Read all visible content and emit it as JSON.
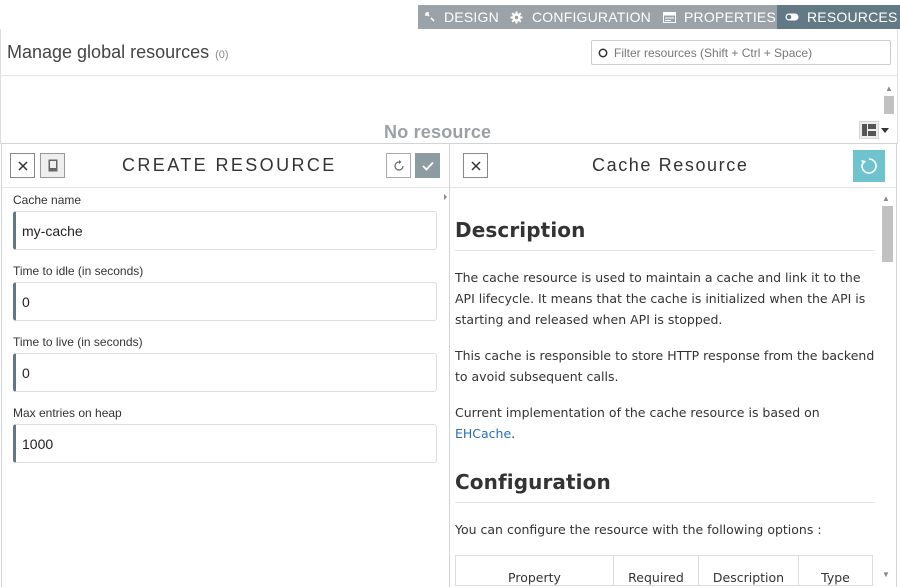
{
  "tabs": {
    "design": "DESIGN",
    "configuration": "CONFIGURATION",
    "properties": "PROPERTIES",
    "resources": "RESOURCES"
  },
  "header": {
    "title": "Manage global resources",
    "count": "(0)",
    "filter_placeholder": "Filter resources (Shift + Ctrl + Space)"
  },
  "list": {
    "empty_text": "No resource"
  },
  "create_panel": {
    "title": "CREATE RESOURCE",
    "fields": [
      {
        "label": "Cache name",
        "value": "my-cache"
      },
      {
        "label": "Time to idle (in seconds)",
        "value": "0"
      },
      {
        "label": "Time to live (in seconds)",
        "value": "0"
      },
      {
        "label": "Max entries on heap",
        "value": "1000"
      }
    ]
  },
  "doc_panel": {
    "title": "Cache Resource",
    "description_heading": "Description",
    "para1": "The cache resource is used to maintain a cache and link it to the API lifecycle. It means that the cache is initialized when the API is starting and released when API is stopped.",
    "para2": "This cache is responsible to store HTTP response from the backend to avoid subsequent calls.",
    "para3_prefix": "Current implementation of the cache resource is based on",
    "para3_link": "EHCache",
    "para3_suffix": ".",
    "config_heading": "Configuration",
    "config_text": "You can configure the resource with the following options :",
    "table_headers": [
      "Property",
      "Required",
      "Description",
      "Type"
    ]
  },
  "colors": {
    "tab_bar": "#9ba3a8",
    "tab_active": "#617a85",
    "accent": "#5f7884",
    "link": "#2a6ebb",
    "refresh_button": "#6fc3cf"
  }
}
